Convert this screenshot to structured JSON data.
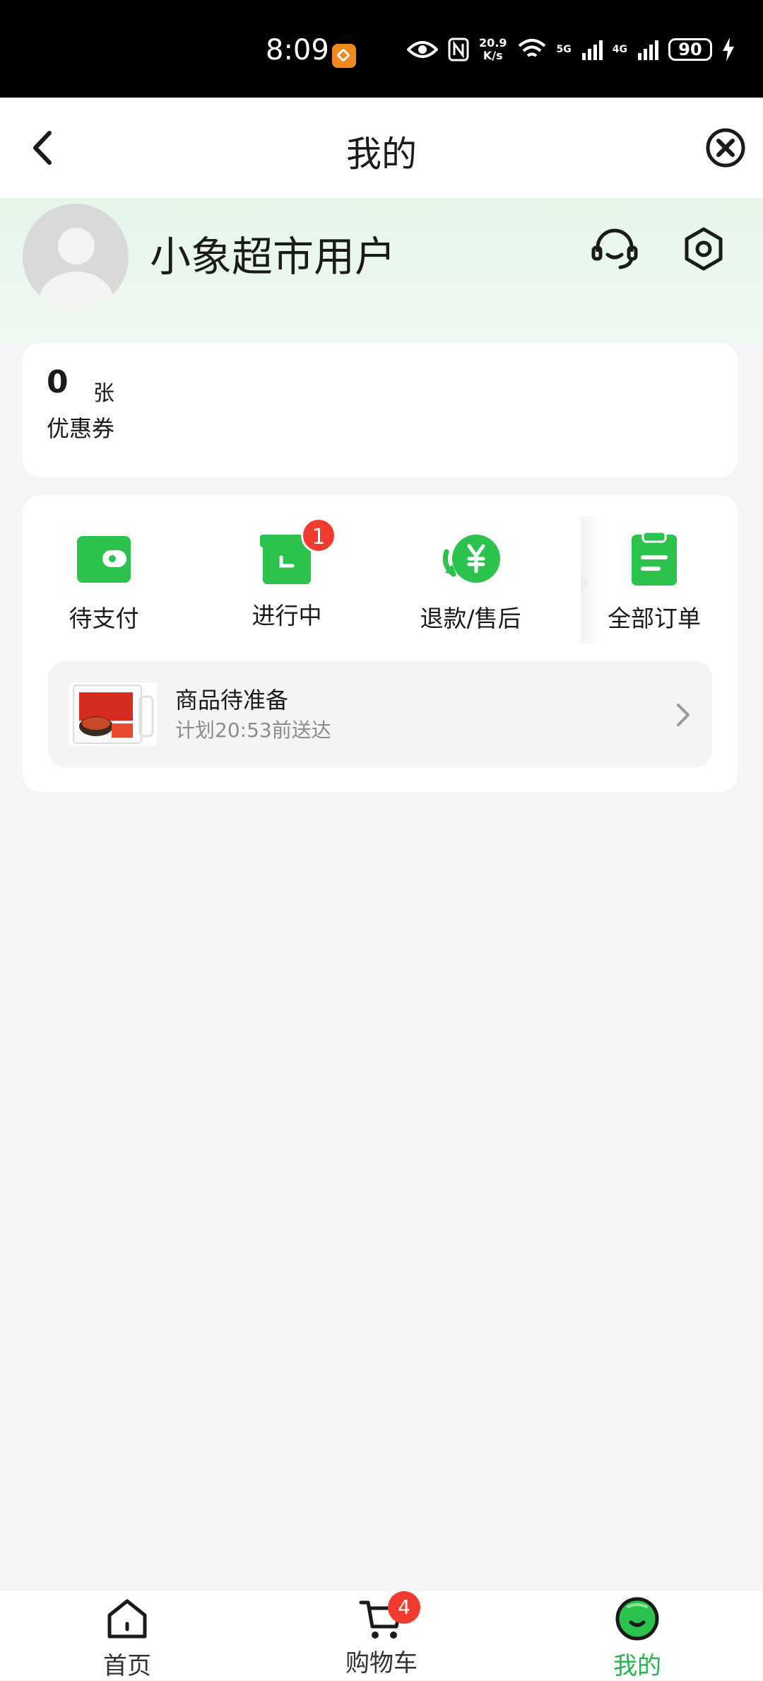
{
  "status_bar": {
    "time": "8:09",
    "net_speed_value": "20.9",
    "net_speed_unit": "K/s",
    "signal_5g": "5G",
    "signal_4g": "4G",
    "battery": "90"
  },
  "header": {
    "title": "我的"
  },
  "profile": {
    "username": "小象超市用户"
  },
  "coupon": {
    "count": "0",
    "unit": "张",
    "label": "优惠券"
  },
  "orders": {
    "items": [
      {
        "label": "待支付",
        "icon": "wallet-icon"
      },
      {
        "label": "进行中",
        "icon": "box-icon",
        "badge": "1"
      },
      {
        "label": "退款/售后",
        "icon": "refund-icon"
      },
      {
        "label": "全部订单",
        "icon": "clipboard-icon"
      }
    ],
    "progress": {
      "title": "商品待准备",
      "subtitle": "计划20:53前送达"
    }
  },
  "bottom_nav": {
    "items": [
      {
        "label": "首页",
        "icon": "home-icon"
      },
      {
        "label": "购物车",
        "icon": "cart-icon",
        "badge": "4"
      },
      {
        "label": "我的",
        "icon": "mine-icon",
        "active": true
      }
    ]
  },
  "colors": {
    "brand_green": "#26b54a",
    "badge_red": "#f23a2f"
  }
}
